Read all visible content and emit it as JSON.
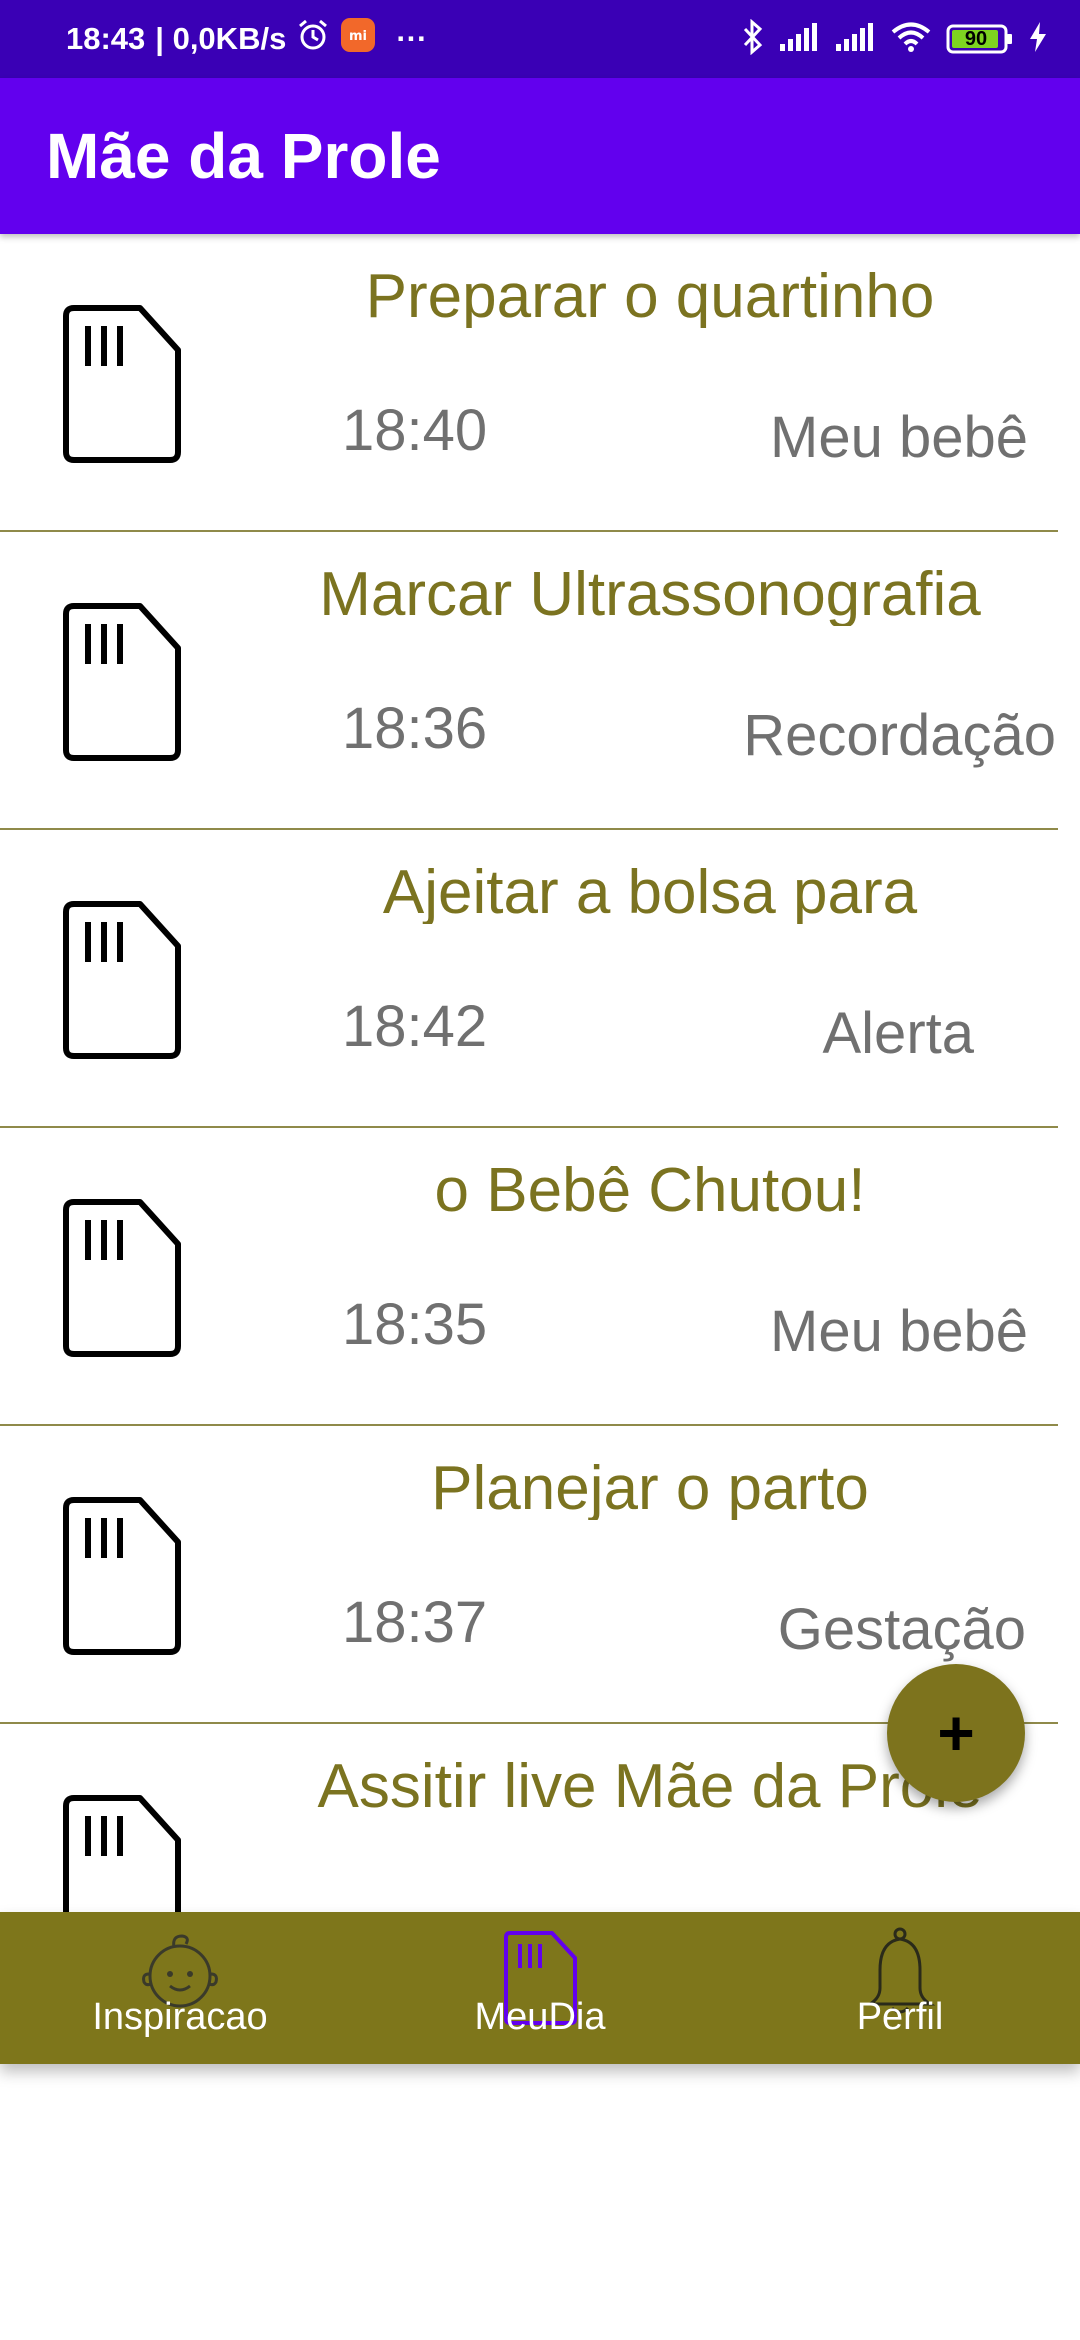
{
  "status_bar": {
    "time": "18:43",
    "network_speed": "| 0,0KB/s",
    "more": "···",
    "battery_level": "90",
    "icons": [
      "alarm-icon",
      "mi-app-icon",
      "bluetooth-icon",
      "signal-icon",
      "wifi-icon",
      "battery-icon",
      "charging-icon"
    ]
  },
  "app_bar": {
    "title": "Mãe da Prole"
  },
  "entries": [
    {
      "title": "Preparar o quartinho",
      "time": "18:40",
      "category": "Meu bebê"
    },
    {
      "title": "Marcar Ultrassonografia",
      "time": "18:36",
      "category": "Recordação"
    },
    {
      "title": "Ajeitar a bolsa para",
      "time": "18:42",
      "category": "Alerta"
    },
    {
      "title": "o Bebê Chutou!",
      "time": "18:35",
      "category": "Meu bebê"
    },
    {
      "title": "Planejar o parto",
      "time": "18:37",
      "category": "Gestação"
    },
    {
      "title": "Assitir live Mãe da Prole",
      "time": "",
      "category": ""
    }
  ],
  "fab": {
    "label": "+"
  },
  "bottom_nav": {
    "items": [
      {
        "label": "Inspiracao",
        "icon": "baby-face-icon",
        "active": false
      },
      {
        "label": "MeuDia",
        "icon": "sd-card-icon",
        "active": true
      },
      {
        "label": "Perfil",
        "icon": "bell-icon",
        "active": false
      }
    ]
  },
  "colors": {
    "status_bar": "#3a00b5",
    "app_bar": "#6200ee",
    "accent": "#7e761b",
    "title_text": "#7b7320",
    "secondary_text": "#707070",
    "active_nav_icon": "#6200ee"
  }
}
